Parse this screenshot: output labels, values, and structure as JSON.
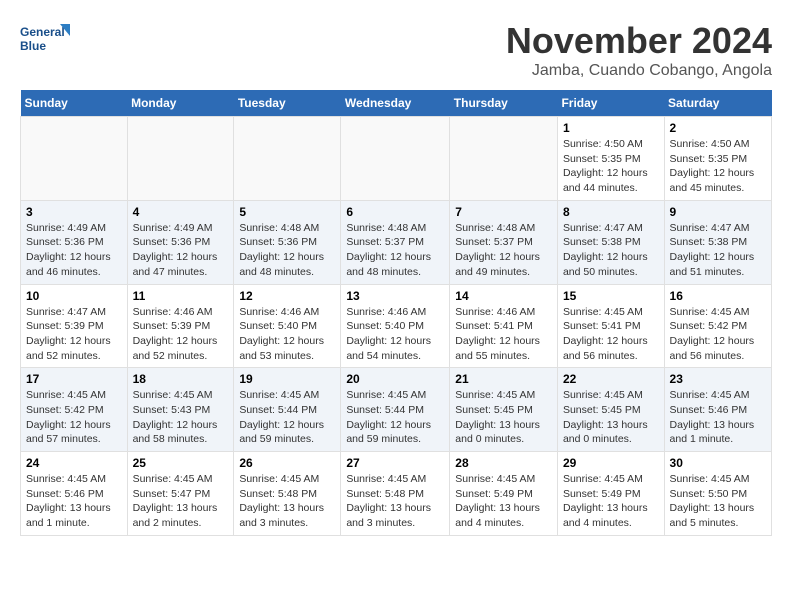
{
  "header": {
    "logo_line1": "General",
    "logo_line2": "Blue",
    "month": "November 2024",
    "location": "Jamba, Cuando Cobango, Angola"
  },
  "weekdays": [
    "Sunday",
    "Monday",
    "Tuesday",
    "Wednesday",
    "Thursday",
    "Friday",
    "Saturday"
  ],
  "weeks": [
    [
      {
        "day": "",
        "info": ""
      },
      {
        "day": "",
        "info": ""
      },
      {
        "day": "",
        "info": ""
      },
      {
        "day": "",
        "info": ""
      },
      {
        "day": "",
        "info": ""
      },
      {
        "day": "1",
        "info": "Sunrise: 4:50 AM\nSunset: 5:35 PM\nDaylight: 12 hours\nand 44 minutes."
      },
      {
        "day": "2",
        "info": "Sunrise: 4:50 AM\nSunset: 5:35 PM\nDaylight: 12 hours\nand 45 minutes."
      }
    ],
    [
      {
        "day": "3",
        "info": "Sunrise: 4:49 AM\nSunset: 5:36 PM\nDaylight: 12 hours\nand 46 minutes."
      },
      {
        "day": "4",
        "info": "Sunrise: 4:49 AM\nSunset: 5:36 PM\nDaylight: 12 hours\nand 47 minutes."
      },
      {
        "day": "5",
        "info": "Sunrise: 4:48 AM\nSunset: 5:36 PM\nDaylight: 12 hours\nand 48 minutes."
      },
      {
        "day": "6",
        "info": "Sunrise: 4:48 AM\nSunset: 5:37 PM\nDaylight: 12 hours\nand 48 minutes."
      },
      {
        "day": "7",
        "info": "Sunrise: 4:48 AM\nSunset: 5:37 PM\nDaylight: 12 hours\nand 49 minutes."
      },
      {
        "day": "8",
        "info": "Sunrise: 4:47 AM\nSunset: 5:38 PM\nDaylight: 12 hours\nand 50 minutes."
      },
      {
        "day": "9",
        "info": "Sunrise: 4:47 AM\nSunset: 5:38 PM\nDaylight: 12 hours\nand 51 minutes."
      }
    ],
    [
      {
        "day": "10",
        "info": "Sunrise: 4:47 AM\nSunset: 5:39 PM\nDaylight: 12 hours\nand 52 minutes."
      },
      {
        "day": "11",
        "info": "Sunrise: 4:46 AM\nSunset: 5:39 PM\nDaylight: 12 hours\nand 52 minutes."
      },
      {
        "day": "12",
        "info": "Sunrise: 4:46 AM\nSunset: 5:40 PM\nDaylight: 12 hours\nand 53 minutes."
      },
      {
        "day": "13",
        "info": "Sunrise: 4:46 AM\nSunset: 5:40 PM\nDaylight: 12 hours\nand 54 minutes."
      },
      {
        "day": "14",
        "info": "Sunrise: 4:46 AM\nSunset: 5:41 PM\nDaylight: 12 hours\nand 55 minutes."
      },
      {
        "day": "15",
        "info": "Sunrise: 4:45 AM\nSunset: 5:41 PM\nDaylight: 12 hours\nand 56 minutes."
      },
      {
        "day": "16",
        "info": "Sunrise: 4:45 AM\nSunset: 5:42 PM\nDaylight: 12 hours\nand 56 minutes."
      }
    ],
    [
      {
        "day": "17",
        "info": "Sunrise: 4:45 AM\nSunset: 5:42 PM\nDaylight: 12 hours\nand 57 minutes."
      },
      {
        "day": "18",
        "info": "Sunrise: 4:45 AM\nSunset: 5:43 PM\nDaylight: 12 hours\nand 58 minutes."
      },
      {
        "day": "19",
        "info": "Sunrise: 4:45 AM\nSunset: 5:44 PM\nDaylight: 12 hours\nand 59 minutes."
      },
      {
        "day": "20",
        "info": "Sunrise: 4:45 AM\nSunset: 5:44 PM\nDaylight: 12 hours\nand 59 minutes."
      },
      {
        "day": "21",
        "info": "Sunrise: 4:45 AM\nSunset: 5:45 PM\nDaylight: 13 hours\nand 0 minutes."
      },
      {
        "day": "22",
        "info": "Sunrise: 4:45 AM\nSunset: 5:45 PM\nDaylight: 13 hours\nand 0 minutes."
      },
      {
        "day": "23",
        "info": "Sunrise: 4:45 AM\nSunset: 5:46 PM\nDaylight: 13 hours\nand 1 minute."
      }
    ],
    [
      {
        "day": "24",
        "info": "Sunrise: 4:45 AM\nSunset: 5:46 PM\nDaylight: 13 hours\nand 1 minute."
      },
      {
        "day": "25",
        "info": "Sunrise: 4:45 AM\nSunset: 5:47 PM\nDaylight: 13 hours\nand 2 minutes."
      },
      {
        "day": "26",
        "info": "Sunrise: 4:45 AM\nSunset: 5:48 PM\nDaylight: 13 hours\nand 3 minutes."
      },
      {
        "day": "27",
        "info": "Sunrise: 4:45 AM\nSunset: 5:48 PM\nDaylight: 13 hours\nand 3 minutes."
      },
      {
        "day": "28",
        "info": "Sunrise: 4:45 AM\nSunset: 5:49 PM\nDaylight: 13 hours\nand 4 minutes."
      },
      {
        "day": "29",
        "info": "Sunrise: 4:45 AM\nSunset: 5:49 PM\nDaylight: 13 hours\nand 4 minutes."
      },
      {
        "day": "30",
        "info": "Sunrise: 4:45 AM\nSunset: 5:50 PM\nDaylight: 13 hours\nand 5 minutes."
      }
    ]
  ]
}
